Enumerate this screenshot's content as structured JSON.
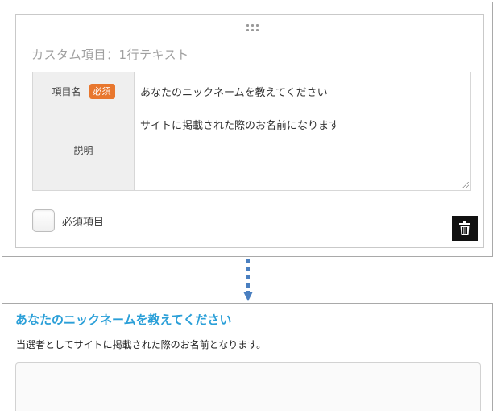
{
  "editor": {
    "card_title": "カスタム項目：1行テキスト",
    "name_header": "項目名",
    "required_badge": "必須",
    "name_value": "あなたのニックネームを教えてください",
    "desc_header": "説明",
    "desc_value": "サイトに掲載された際のお名前になります",
    "required_checkbox_label": "必須項目",
    "required_checked": false
  },
  "preview": {
    "title": "あなたのニックネームを教えてください",
    "description": "当選者としてサイトに掲載された際のお名前となります。",
    "input_value": ""
  },
  "icons": {
    "drag": "drag-handle-icon",
    "delete": "trash-icon",
    "arrow": "arrow-down-icon"
  },
  "colors": {
    "badge": "#e8772e",
    "preview_title": "#2a9fd8",
    "arrow": "#4a7fc0",
    "delete_button": "#111111"
  }
}
